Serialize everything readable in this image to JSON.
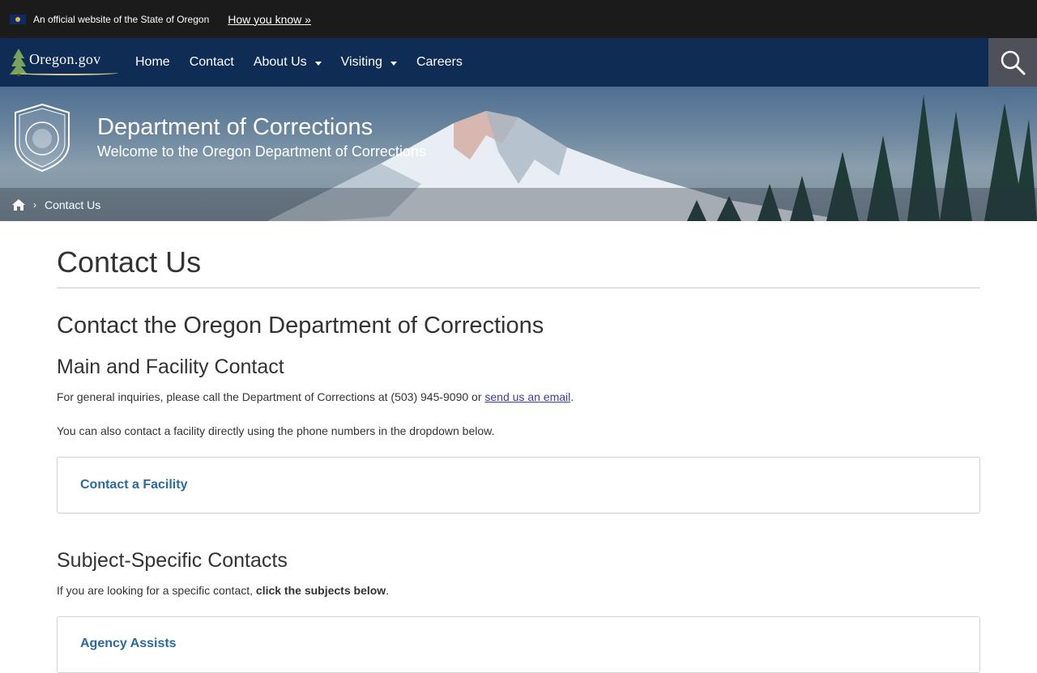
{
  "official_bar": {
    "text": "An official website of the State of Oregon",
    "how_you_know": "How you know »"
  },
  "nav": {
    "logo_text": "Oregon.gov",
    "items": [
      {
        "label": "Home",
        "dropdown": false
      },
      {
        "label": "Contact",
        "dropdown": false
      },
      {
        "label": "About Us",
        "dropdown": true
      },
      {
        "label": "Visiting",
        "dropdown": true
      },
      {
        "label": "Careers",
        "dropdown": false
      }
    ],
    "search_icon": "search-icon"
  },
  "hero": {
    "title": "Department of Corrections",
    "subtitle": "Welcome to the Oregon Department of Corrections",
    "seal_icon": "oregon-doc-seal-icon"
  },
  "breadcrumb": {
    "home_icon": "home-icon",
    "current": "Contact Us"
  },
  "main": {
    "page_title": "Contact Us",
    "heading": "Contact the Oregon Department of Corrections",
    "section1_heading": "Main and Facility Contact",
    "section1_text_before": "For general inquiries, please call the Department of Corrections at (503) 945-9090 or ",
    "section1_link": "send us an email",
    "section1_text_after": ".",
    "section1_text2": "You can also contact a facility directly using the phone numbers in the dropdown below.",
    "accordion1_label": "Contact a Facility",
    "section2_heading": "Subject-Specific Contacts",
    "section2_text_before": "If you are looking for a specific contact, ",
    "section2_text_bold": "click the subjects below",
    "section2_text_after": ".",
    "accordion2_label": "Agency Assists"
  },
  "colors": {
    "nav_bg": "#0e2c54",
    "official_bg": "#1b1b1b",
    "accordion_label": "#2a6aa3",
    "link": "#3b3ba6"
  }
}
